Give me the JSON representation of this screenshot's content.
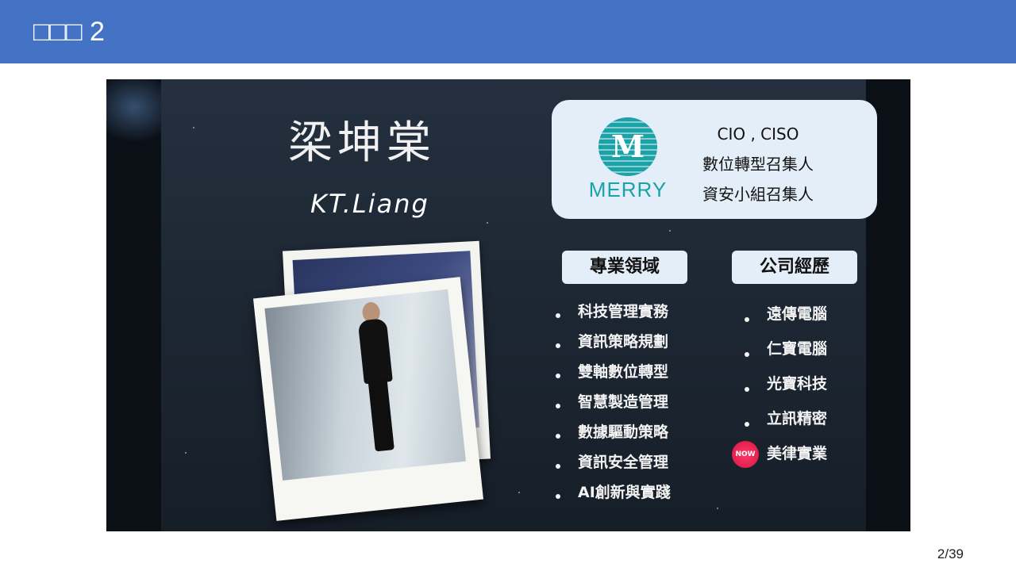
{
  "header": {
    "title": "□□□ 2",
    "background_color": "#4472c4"
  },
  "footer": {
    "page_number": "2/39"
  },
  "slide": {
    "name_chinese": "梁坤棠",
    "name_english": "KT.Liang",
    "company_logo": {
      "icon": "merry-logo-icon",
      "logo_mark": "M",
      "logo_text": "MERRY",
      "brand_color": "#1aa3a6"
    },
    "roles": [
      "CIO , CISO",
      "數位轉型召集人",
      "資安小組召集人"
    ],
    "expertise": {
      "heading": "專業領域",
      "items": [
        "科技管理實務",
        "資訊策略規劃",
        "雙軸數位轉型",
        "智慧製造管理",
        "數據驅動策略",
        "資訊安全管理",
        "AI創新與實踐"
      ]
    },
    "experience": {
      "heading": "公司經歷",
      "items": [
        "遠傳電腦",
        "仁寶電腦",
        "光寶科技",
        "立訊精密"
      ],
      "current": {
        "badge": "NOW",
        "label": "美律實業"
      }
    }
  }
}
